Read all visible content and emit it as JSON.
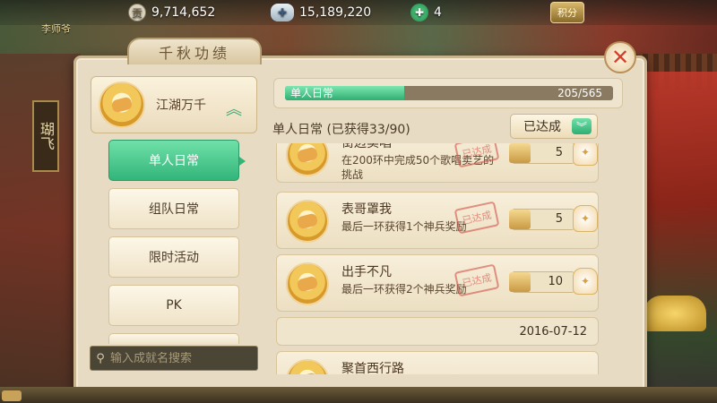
{
  "topbar": {
    "gold": {
      "icon": "honor-coin-icon",
      "glyph": "贡",
      "value": "9,714,652"
    },
    "silver": {
      "icon": "silver-ingot-icon",
      "value": "15,189,220"
    },
    "jade": {
      "icon": "jade-icon",
      "value": "4"
    },
    "score_button": "积分"
  },
  "npc_name": "李师爷",
  "scene": {
    "sign_text": "瑚飞"
  },
  "panel": {
    "title": "千秋功绩",
    "close_glyph": "✕"
  },
  "category": {
    "title": "江湖万千",
    "expanded_glyph": "︽"
  },
  "sidebar": {
    "items": [
      {
        "label": "单人日常",
        "active": true
      },
      {
        "label": "组队日常",
        "active": false
      },
      {
        "label": "限时活动",
        "active": false
      },
      {
        "label": "PK",
        "active": false
      }
    ]
  },
  "search": {
    "placeholder": "输入成就名搜索",
    "icon_glyph": "⚲"
  },
  "progress": {
    "label": "单人日常",
    "count": "205/565",
    "fraction": 0.363
  },
  "section": {
    "title": "单人日常 (已获得33/90)",
    "filter_value": "已达成",
    "filter_arrow": "︾"
  },
  "achievements": [
    {
      "name": "街边卖唱",
      "desc": "在200环中完成50个歌唱卖艺的挑战",
      "stamp": "已达成",
      "reward": "5"
    },
    {
      "name": "表哥罩我",
      "desc": "最后一环获得1个神兵奖励",
      "stamp": "已达成",
      "reward": "5"
    },
    {
      "name": "出手不凡",
      "desc": "最后一环获得2个神兵奖励",
      "stamp": "已达成",
      "reward": "10"
    }
  ],
  "date_separator": "2016-07-12",
  "next_achievement": {
    "name": "聚首西行路"
  },
  "colors": {
    "accent_green": "#33b57a",
    "close_red": "#d1402b",
    "panel_bg": "#e7dbc4"
  }
}
